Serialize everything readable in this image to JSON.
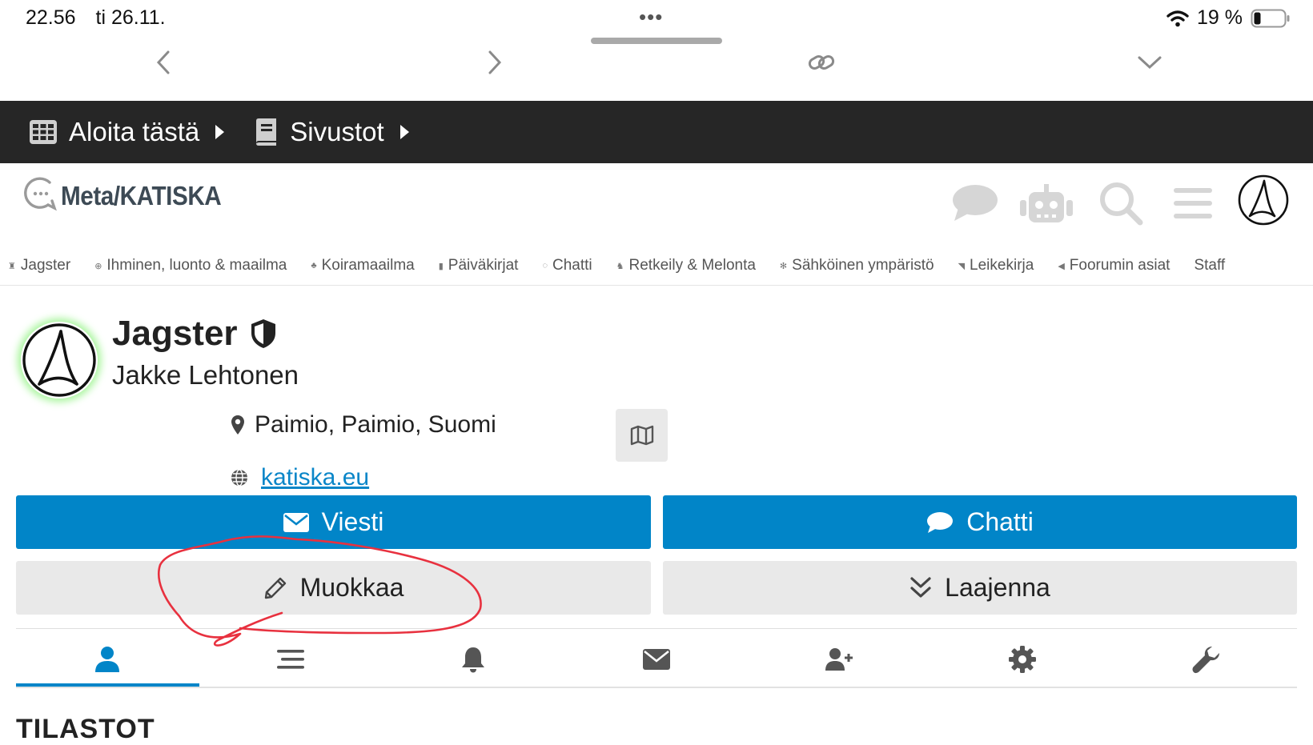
{
  "status_bar": {
    "time": "22.56",
    "date": "ti 26.11.",
    "battery": "19 %"
  },
  "top_bar": {
    "items": [
      {
        "label": "Aloita tästä",
        "icon": "grid-icon"
      },
      {
        "label": "Sivustot",
        "icon": "book-icon"
      }
    ]
  },
  "header": {
    "logo_text": "Meta/KATISKA",
    "icons": [
      "chat-icon",
      "robot-icon",
      "search-icon",
      "menu-icon",
      "avatar"
    ]
  },
  "categories": [
    "Jagster",
    "Ihminen, luonto & maailma",
    "Koiramaailma",
    "Päiväkirjat",
    "Chatti",
    "Retkeily & Melonta",
    "Sähköinen ympäristö",
    "Leikekirja",
    "Foorumin asiat",
    "Staff"
  ],
  "profile": {
    "username": "Jagster",
    "real_name": "Jakke Lehtonen",
    "location": "Paimio, Paimio, Suomi",
    "website": "katiska.eu"
  },
  "buttons": {
    "message": "Viesti",
    "chat": "Chatti",
    "edit": "Muokkaa",
    "expand": "Laajenna"
  },
  "tabs": [
    "profile-icon",
    "activity-icon",
    "notifications-icon",
    "messages-icon",
    "invite-icon",
    "preferences-icon",
    "admin-icon"
  ],
  "section_title": "TILASTOT",
  "colors": {
    "accent": "#0185c8",
    "dark_bar": "#262626",
    "annotation": "#e8313f",
    "avatar_glow": "#a6f59a"
  }
}
